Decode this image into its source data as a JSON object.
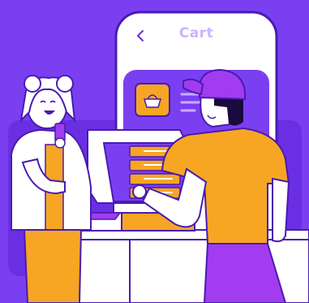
{
  "screen": {
    "title": "Cart",
    "back_icon": "chevron-left-icon",
    "basket_icon": "shopping-basket-icon"
  },
  "palette": {
    "background": "#7b3ff2",
    "panel": "#6a2fe3",
    "accent_orange": "#f6a623",
    "accent_purple": "#a23cf0",
    "text_purple": "#cdb1ff",
    "white": "#ffffff"
  }
}
